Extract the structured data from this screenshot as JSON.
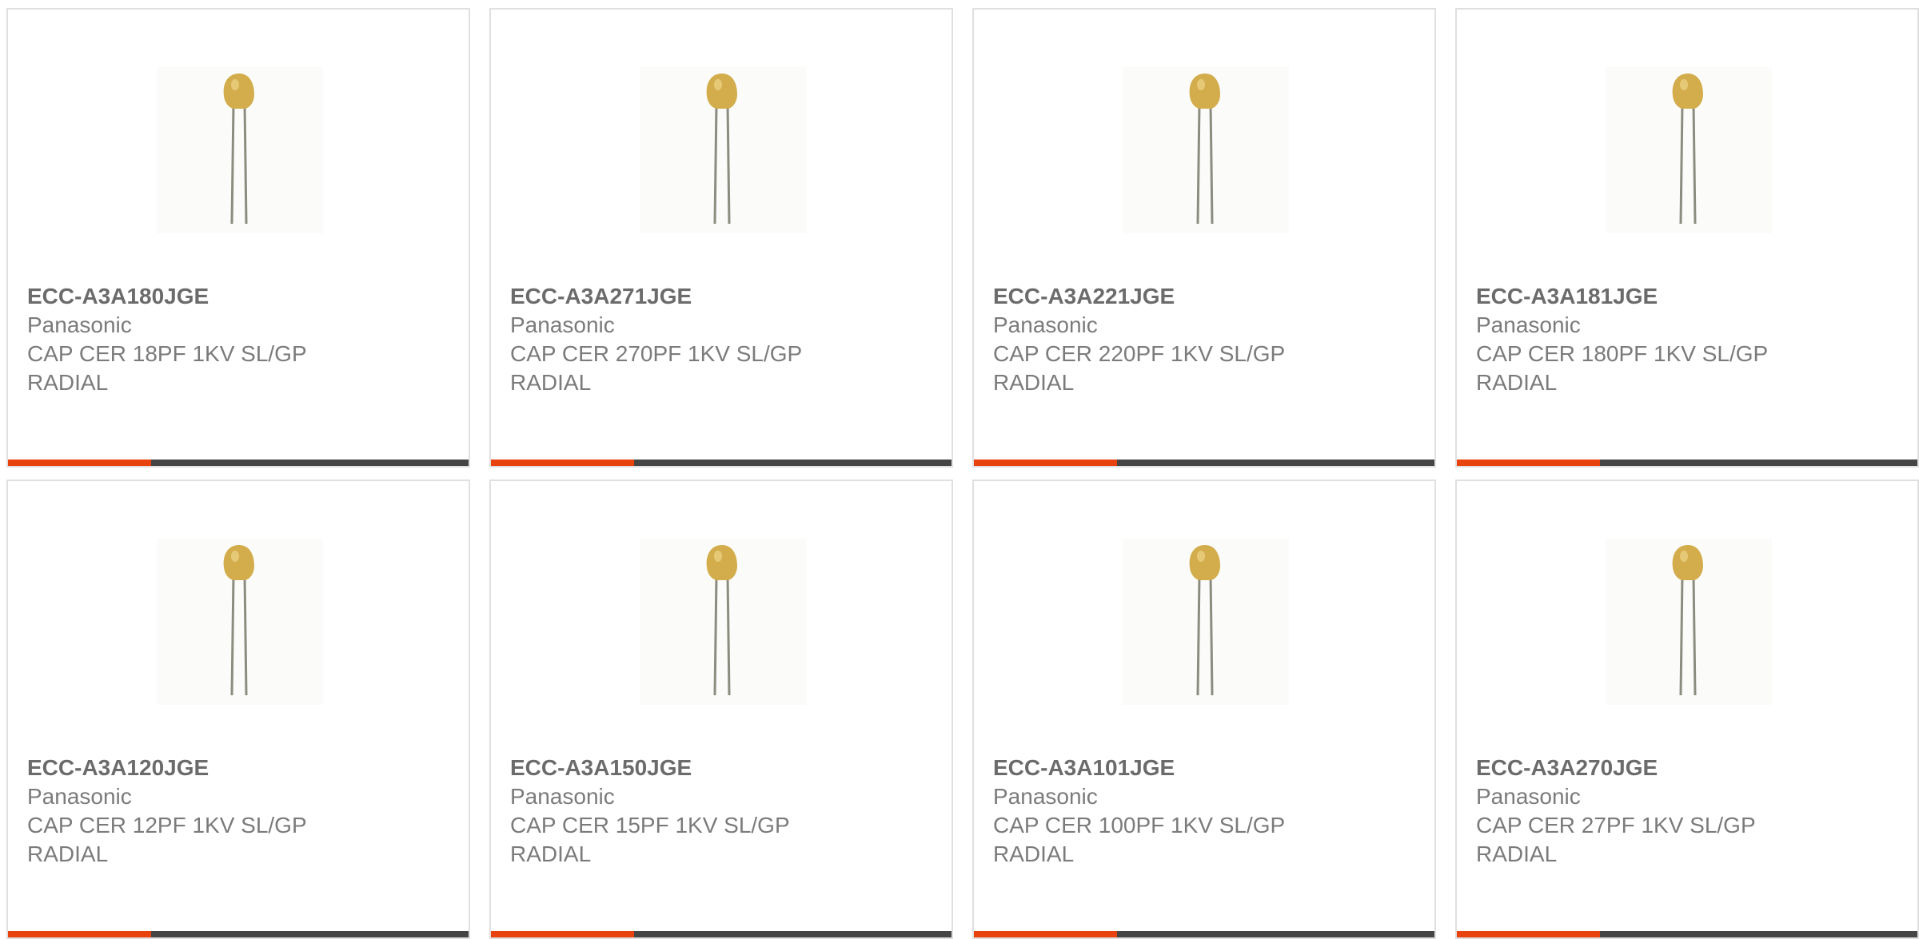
{
  "colors": {
    "accent": "#e8420f",
    "bar_dark": "#454545",
    "text": "#7b7b7b",
    "capacitor_body": "#d3ad4b",
    "lead": "#8c8c80"
  },
  "icons": {
    "product_image": "ceramic-disc-capacitor-image"
  },
  "bar_accent_fraction": 0.31,
  "products": [
    {
      "part": "ECC-A3A180JGE",
      "manufacturer": "Panasonic",
      "description": "CAP CER 18PF 1KV SL/GP\nRADIAL"
    },
    {
      "part": "ECC-A3A271JGE",
      "manufacturer": "Panasonic",
      "description": "CAP CER 270PF 1KV SL/GP\nRADIAL"
    },
    {
      "part": "ECC-A3A221JGE",
      "manufacturer": "Panasonic",
      "description": "CAP CER 220PF 1KV SL/GP\nRADIAL"
    },
    {
      "part": "ECC-A3A181JGE",
      "manufacturer": "Panasonic",
      "description": "CAP CER 180PF 1KV SL/GP\nRADIAL"
    },
    {
      "part": "ECC-A3A120JGE",
      "manufacturer": "Panasonic",
      "description": "CAP CER 12PF 1KV SL/GP\nRADIAL"
    },
    {
      "part": "ECC-A3A150JGE",
      "manufacturer": "Panasonic",
      "description": "CAP CER 15PF 1KV SL/GP\nRADIAL"
    },
    {
      "part": "ECC-A3A101JGE",
      "manufacturer": "Panasonic",
      "description": "CAP CER 100PF 1KV SL/GP\nRADIAL"
    },
    {
      "part": "ECC-A3A270JGE",
      "manufacturer": "Panasonic",
      "description": "CAP CER 27PF 1KV SL/GP\nRADIAL"
    }
  ]
}
